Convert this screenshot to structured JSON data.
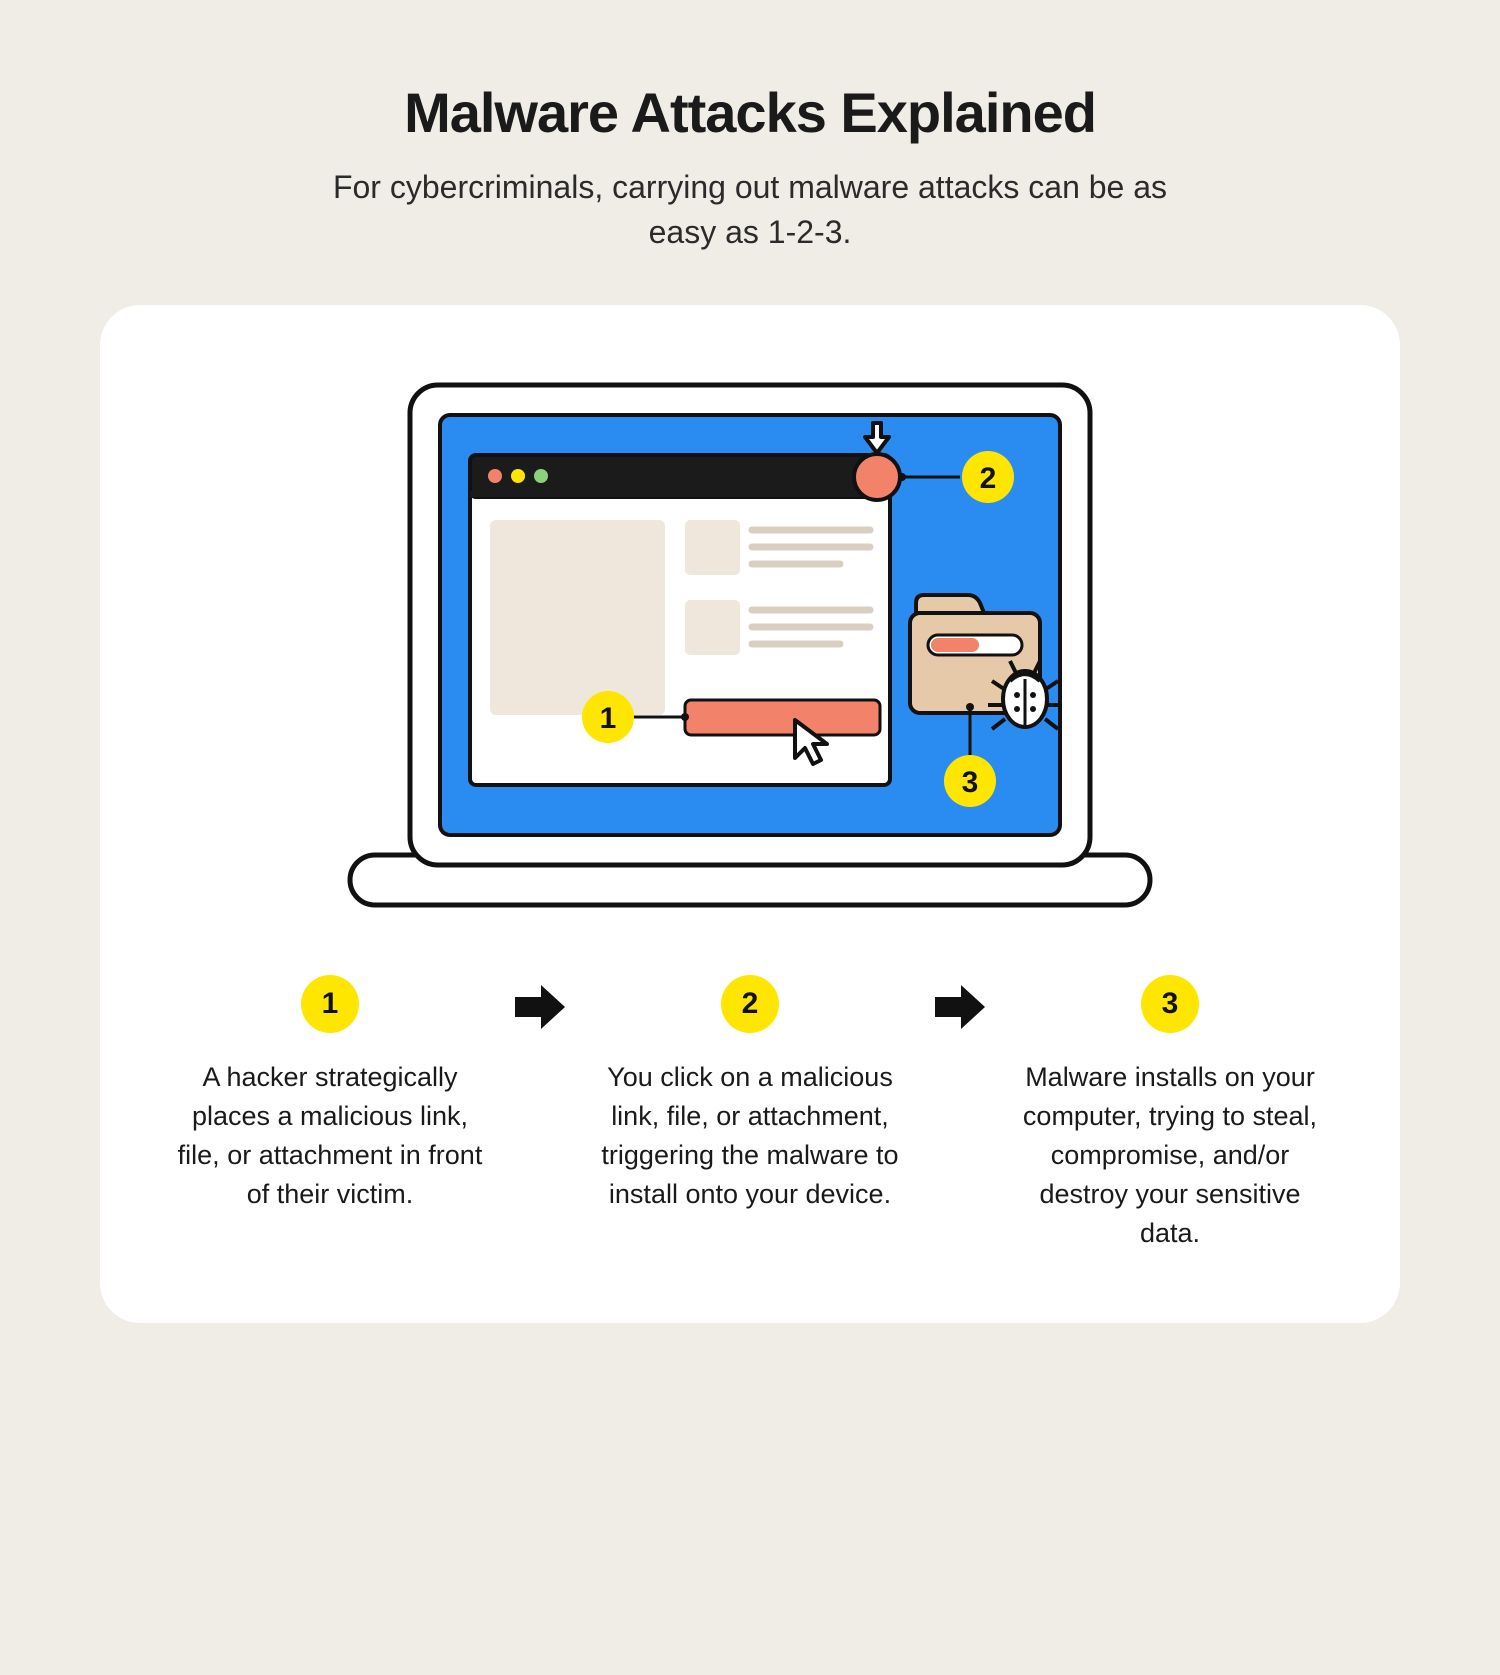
{
  "header": {
    "title": "Malware Attacks Explained",
    "subtitle": "For cybercriminals, carrying out malware attacks can be as easy as 1-2-3."
  },
  "illustration": {
    "badges": {
      "one": "1",
      "two": "2",
      "three": "3"
    }
  },
  "steps": [
    {
      "num": "1",
      "text": "A hacker strategically places a malicious link, file, or attachment in front of their victim."
    },
    {
      "num": "2",
      "text": "You click on a malicious link, file, or attachment, triggering the malware to install onto your device."
    },
    {
      "num": "3",
      "text": "Malware installs on your computer, trying to steal, compromise, and/or destroy your sensitive data."
    }
  ],
  "colors": {
    "accentYellow": "#ffe600",
    "screenBlue": "#2a8cf0",
    "coral": "#f2836a",
    "folder": "#e6c9a8"
  }
}
